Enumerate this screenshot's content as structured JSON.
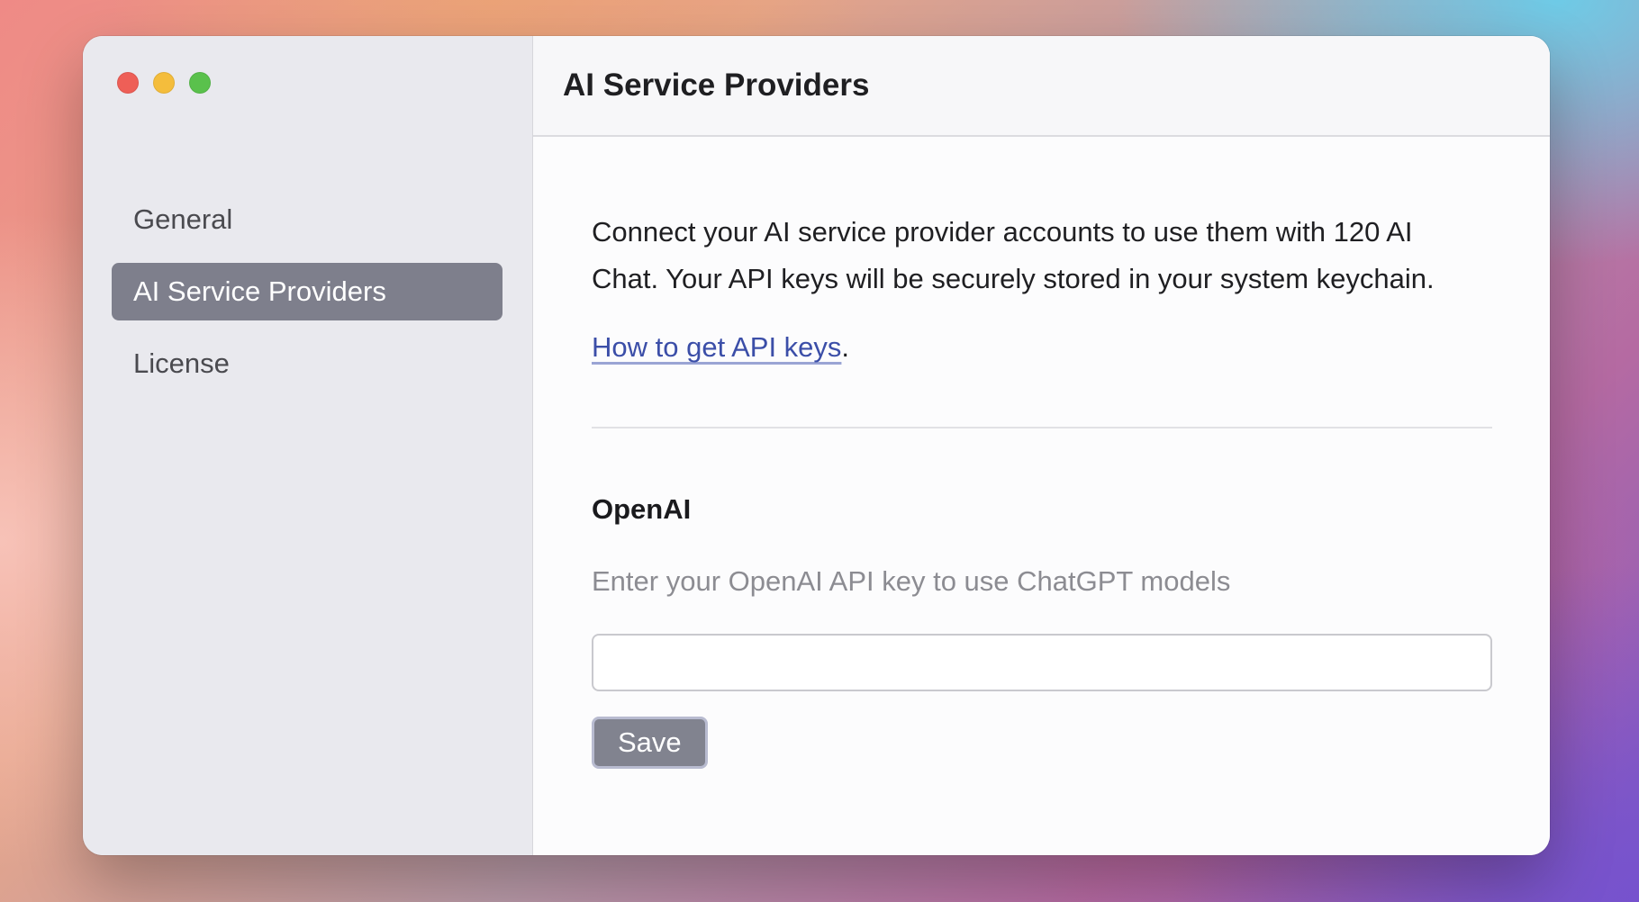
{
  "window": {
    "traffic_lights": [
      "close",
      "minimize",
      "zoom"
    ]
  },
  "sidebar": {
    "items": [
      {
        "label": "General",
        "active": false
      },
      {
        "label": "AI Service Providers",
        "active": true
      },
      {
        "label": "License",
        "active": false
      }
    ]
  },
  "main": {
    "title": "AI Service Providers",
    "intro_line1": "Connect your AI service provider accounts to use them with 120 AI",
    "intro_line2": "Chat. Your API keys will be securely stored in your system keychain.",
    "link_text": "How to get API keys",
    "link_suffix": ".",
    "provider": {
      "name": "OpenAI",
      "description": "Enter your OpenAI API key to use ChatGPT models",
      "api_key_value": "",
      "save_label": "Save"
    }
  },
  "colors": {
    "active_nav_bg": "#7e7f8c",
    "link": "#3b4ea8",
    "save_button_bg": "#81838f"
  }
}
